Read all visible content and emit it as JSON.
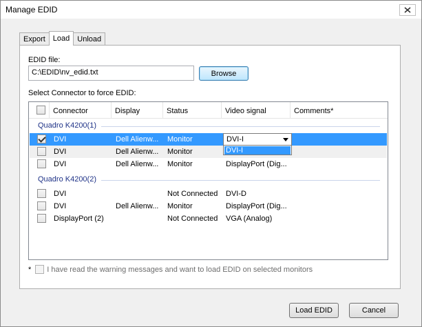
{
  "window": {
    "title": "Manage EDID"
  },
  "tabs": [
    {
      "label": "Export"
    },
    {
      "label": "Load"
    },
    {
      "label": "Unload"
    }
  ],
  "load": {
    "edid_file_label": "EDID file:",
    "edid_file_value": "C:\\EDID\\nv_edid.txt",
    "browse_label": "Browse",
    "select_connector_label": "Select Connector to force EDID:"
  },
  "table": {
    "columns": [
      "Connector",
      "Display",
      "Status",
      "Video signal",
      "Comments*"
    ],
    "groups": [
      {
        "name": "Quadro K4200(1)",
        "rows": [
          {
            "checked": true,
            "connector": "DVI",
            "display": "Dell Alienw...",
            "status": "Monitor",
            "video_signal": "DVI-I",
            "comments": ""
          },
          {
            "checked": false,
            "connector": "DVI",
            "display": "Dell Alienw...",
            "status": "Monitor",
            "video_signal": "",
            "comments": ""
          },
          {
            "checked": false,
            "connector": "DVI",
            "display": "Dell Alienw...",
            "status": "Monitor",
            "video_signal": "DisplayPort (Dig...",
            "comments": ""
          }
        ]
      },
      {
        "name": "Quadro K4200(2)",
        "rows": [
          {
            "checked": false,
            "connector": "DVI",
            "display": "",
            "status": "Not Connected",
            "video_signal": "DVI-D",
            "comments": ""
          },
          {
            "checked": false,
            "connector": "DVI",
            "display": "Dell Alienw...",
            "status": "Monitor",
            "video_signal": "DisplayPort (Dig...",
            "comments": ""
          },
          {
            "checked": false,
            "connector": "DisplayPort (2)",
            "display": "",
            "status": "Not Connected",
            "video_signal": "VGA (Analog)",
            "comments": ""
          }
        ]
      }
    ],
    "video_signal_dropdown": {
      "selected": "DVI-I",
      "options": [
        "DVI-I"
      ]
    }
  },
  "warning": {
    "asterisk": "*",
    "text": "I have read the warning messages and want to load EDID on selected monitors",
    "checked": false
  },
  "buttons": {
    "load_edid": "Load EDID",
    "cancel": "Cancel"
  },
  "colors": {
    "selection": "#3399ff",
    "group_header": "#1e3287"
  }
}
